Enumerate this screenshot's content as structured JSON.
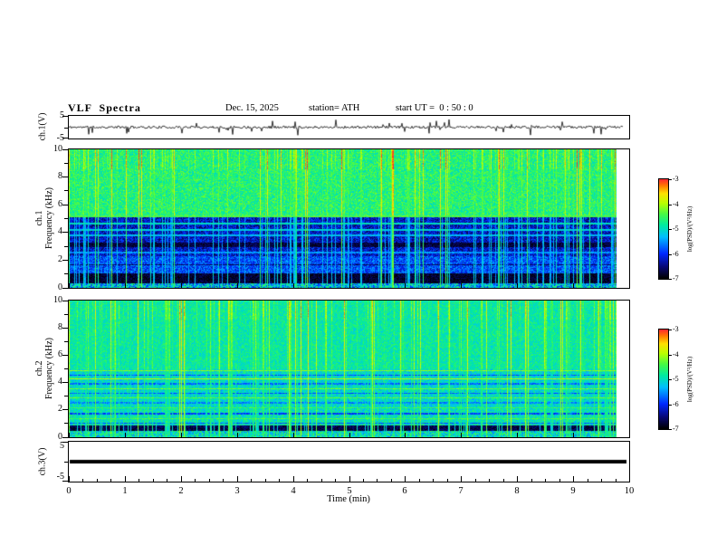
{
  "title": {
    "main": "VLF  Spectra",
    "date": "Dec. 15, 2025",
    "station": "station= ATH",
    "start_ut": "start UT =  0 : 50 : 0"
  },
  "x_axis": {
    "label": "Time (min)",
    "min": 0,
    "max": 10,
    "tick_labels": [
      "0",
      "1",
      "2",
      "3",
      "4",
      "5",
      "6",
      "7",
      "8",
      "9",
      "10"
    ]
  },
  "colorbar": {
    "label": "log(PSD)/(V²/Hz)",
    "tick_labels": [
      "-3",
      "-4",
      "-5",
      "-6",
      "-7"
    ],
    "vmax": -3,
    "vmin": -7,
    "colormap": "rainbow (red=high power, black=low power)"
  },
  "panels": {
    "ch1_wave": {
      "ylabel": "ch.1(V)",
      "ytick_top": "5",
      "ytick_bottom": "-5",
      "ylim": [
        -5,
        5
      ]
    },
    "ch1_spec": {
      "ylabel_line1": "ch.1",
      "ylabel_line2": "Frequency (kHz)",
      "ytick_labels": [
        "10",
        "8",
        "6",
        "4",
        "2",
        "0"
      ],
      "ylim_khz": [
        0,
        10
      ]
    },
    "ch2_spec": {
      "ylabel_line1": "ch.2",
      "ylabel_line2": "Frequency (kHz)",
      "ytick_labels": [
        "10",
        "8",
        "6",
        "4",
        "2",
        "0"
      ],
      "ylim_khz": [
        0,
        10
      ]
    },
    "ch3_wave": {
      "ylabel": "ch.3(V)",
      "ytick_top": "5",
      "ytick_bottom": "-5",
      "ylim": [
        -5,
        5
      ]
    }
  },
  "chart_data": [
    {
      "type": "line",
      "name": "ch1_waveform",
      "ylabel": "ch.1(V)",
      "ylim": [
        -5,
        5
      ],
      "xlim": [
        0,
        10
      ],
      "data_end_min": 9.88,
      "description": "Broadband VLF receiver channel-1 voltage: continuous noise of roughly ±0.6 V with many impulsive sferic spikes reaching about ±4 V throughout the 10-minute record",
      "noise_amp": 0.6,
      "spike_prob": 0.05,
      "spike_amp": 3.6,
      "seed": 11
    },
    {
      "type": "heatmap",
      "name": "ch1_spectrogram",
      "xlim": [
        0,
        10
      ],
      "ylim_khz": [
        0,
        10
      ],
      "value_range": [
        -7,
        -3
      ],
      "colormap": "rainbow",
      "data_end_min": 9.78,
      "description": "0–1 kHz: near-black quiet band; 1–5 kHz: dark-blue low-power region crossed by narrow cyan horizontal lines near 2.5, 3.8, 4.2 and 4.7 kHz; 5–10 kHz: green/teal broadband hiss; dense vertical yellow-to-red streaks (lightning sferics) cut across all frequencies",
      "seed": 7,
      "bands": [
        {
          "f": [
            5.2,
            10.01
          ],
          "level": -4.65,
          "noise": 0.45
        },
        {
          "f": [
            2.3,
            5.2
          ],
          "level": -6.25,
          "noise": 0.5
        },
        {
          "f": [
            1.05,
            2.3
          ],
          "level": -5.85,
          "noise": 0.5
        },
        {
          "f": [
            0.3,
            1.05
          ],
          "level": -6.8,
          "noise": 0.25
        },
        {
          "f": [
            0.0,
            0.3
          ],
          "level": -5.3,
          "noise": 0.9
        }
      ],
      "hlines": [
        {
          "f": 5.15,
          "w": 0.12,
          "level": -4.4
        },
        {
          "f": 4.65,
          "w": 0.14,
          "level": -5.0
        },
        {
          "f": 4.2,
          "w": 0.12,
          "level": -5.15
        },
        {
          "f": 3.8,
          "w": 0.1,
          "level": -5.3
        },
        {
          "f": 3.1,
          "w": 0.3,
          "level": -6.75
        },
        {
          "f": 2.55,
          "w": 0.12,
          "level": -5.5
        },
        {
          "f": 1.65,
          "w": 0.1,
          "level": -6.6
        }
      ],
      "streaks": {
        "strong_prob": 0.07,
        "strong_level": -3.75,
        "medium_prob": 0.2,
        "medium_level": -4.55,
        "attenuate_below_khz": 5.2,
        "attenuation": 0.75,
        "top_boost_above_khz": 8.6,
        "top_boost": 0.4
      }
    },
    {
      "type": "heatmap",
      "name": "ch2_spectrogram",
      "xlim": [
        0,
        10
      ],
      "ylim_khz": [
        0,
        10
      ],
      "value_range": [
        -7,
        -3
      ],
      "colormap": "rainbow",
      "data_end_min": 9.78,
      "description": "Mostly green/cyan broadband power at all frequencies with many thin horizontal interference lines between 1 and 5 kHz (some orange, some dark), a black quiet band near 0.5–0.8 kHz, and dense vertical sferic streaks",
      "seed": 19,
      "bands": [
        {
          "f": [
            5.0,
            10.01
          ],
          "level": -4.85,
          "noise": 0.35
        },
        {
          "f": [
            2.0,
            5.0
          ],
          "level": -5.05,
          "noise": 0.45
        },
        {
          "f": [
            0.8,
            2.0
          ],
          "level": -4.95,
          "noise": 0.5
        },
        {
          "f": [
            0.45,
            0.8
          ],
          "level": -6.7,
          "noise": 0.3
        },
        {
          "f": [
            0.0,
            0.45
          ],
          "level": -5.0,
          "noise": 0.7
        }
      ],
      "hlines": [
        {
          "f": 4.85,
          "w": 0.08,
          "level": -4.15
        },
        {
          "f": 4.55,
          "w": 0.07,
          "level": -5.85
        },
        {
          "f": 4.25,
          "w": 0.08,
          "level": -3.95
        },
        {
          "f": 3.9,
          "w": 0.07,
          "level": -5.7
        },
        {
          "f": 3.55,
          "w": 0.08,
          "level": -4.25
        },
        {
          "f": 3.2,
          "w": 0.07,
          "level": -5.8
        },
        {
          "f": 2.85,
          "w": 0.08,
          "level": -4.35
        },
        {
          "f": 2.5,
          "w": 0.07,
          "level": -5.6
        },
        {
          "f": 2.15,
          "w": 0.07,
          "level": -4.5
        },
        {
          "f": 1.7,
          "w": 0.07,
          "level": -5.9
        },
        {
          "f": 1.35,
          "w": 0.08,
          "level": -4.4
        },
        {
          "f": 1.0,
          "w": 0.06,
          "level": -5.8
        }
      ],
      "streaks": {
        "strong_prob": 0.06,
        "strong_level": -3.9,
        "medium_prob": 0.2,
        "medium_level": -4.6,
        "attenuate_below_khz": 5.0,
        "attenuation": 0.3,
        "top_boost_above_khz": 8.6,
        "top_boost": 0.25
      }
    },
    {
      "type": "line",
      "name": "ch3_waveform",
      "ylabel": "ch.3(V)",
      "ylim": [
        -5,
        5
      ],
      "xlim": [
        0,
        10
      ],
      "data_end_min": 9.93,
      "constant_value": 0,
      "description": "Channel-3 voltage is a flat thick black trace at 0 V for the whole record (dead/saturated channel)"
    }
  ]
}
